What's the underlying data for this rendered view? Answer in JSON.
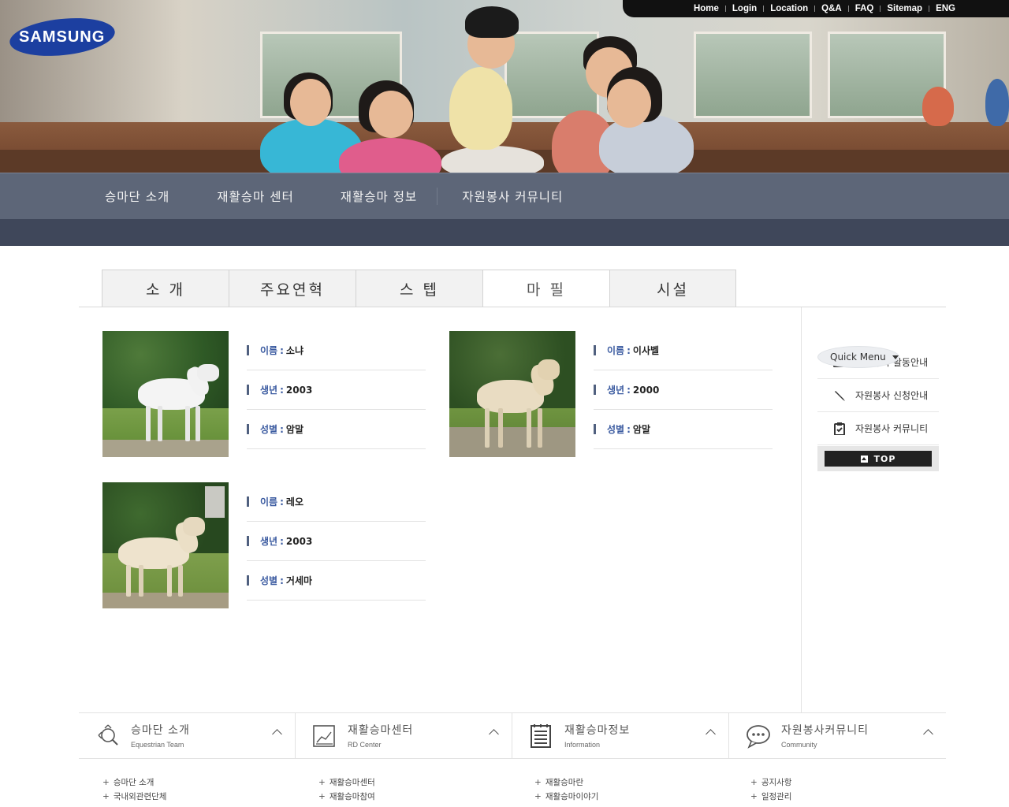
{
  "brand": {
    "logo_text": "SAMSUNG"
  },
  "utility_nav": [
    "Home",
    "Login",
    "Location",
    "Q&A",
    "FAQ",
    "Sitemap",
    "ENG"
  ],
  "main_nav": [
    "승마단 소개",
    "재활승마 센터",
    "재활승마 정보",
    "자원봉사 커뮤니티"
  ],
  "tabs": [
    {
      "label": "소 개",
      "active": false
    },
    {
      "label": "주요연혁",
      "active": false
    },
    {
      "label": "스 텝",
      "active": false
    },
    {
      "label": "마 필",
      "active": true
    },
    {
      "label": "시설",
      "active": false
    }
  ],
  "horses": [
    {
      "name_label": "이름",
      "name": "소냐",
      "year_label": "생년",
      "year": "2003",
      "sex_label": "성별",
      "sex": "암말"
    },
    {
      "name_label": "이름",
      "name": "이사벨",
      "year_label": "생년",
      "year": "2000",
      "sex_label": "성별",
      "sex": "암말"
    },
    {
      "name_label": "이름",
      "name": "레오",
      "year_label": "생년",
      "year": "2003",
      "sex_label": "성별",
      "sex": "거세마"
    }
  ],
  "quick_menu": {
    "title": "Quick Menu",
    "items": [
      {
        "label": "자원봉사 활동안내",
        "icon": "keyboard-icon"
      },
      {
        "label": "자원봉사 신청안내",
        "icon": "pen-icon"
      },
      {
        "label": "자원봉사 커뮤니티",
        "icon": "checklist-icon"
      }
    ],
    "top_label": "TOP"
  },
  "footer": {
    "columns": [
      {
        "title": "승마단 소개",
        "subtitle": "Equestrian Team",
        "icon": "search-icon",
        "links": [
          "승마단 소개",
          "국내외관련단체"
        ]
      },
      {
        "title": "재활승마센터",
        "subtitle": "RD Center",
        "icon": "chart-icon",
        "links": [
          "재활승마센터",
          "재활승마참여"
        ]
      },
      {
        "title": "재활승마정보",
        "subtitle": "Information",
        "icon": "notepad-icon",
        "links": [
          "재활승마란",
          "재활승마이야기"
        ]
      },
      {
        "title": "자원봉사커뮤니티",
        "subtitle": "Community",
        "icon": "chat-icon",
        "links": [
          "공지사항",
          "일정관리"
        ]
      }
    ]
  },
  "colors": {
    "nav_bg": "#5d6678",
    "subnav_bg": "#3f475a",
    "label_blue": "#3a5aa0",
    "bar": "#50607f"
  }
}
